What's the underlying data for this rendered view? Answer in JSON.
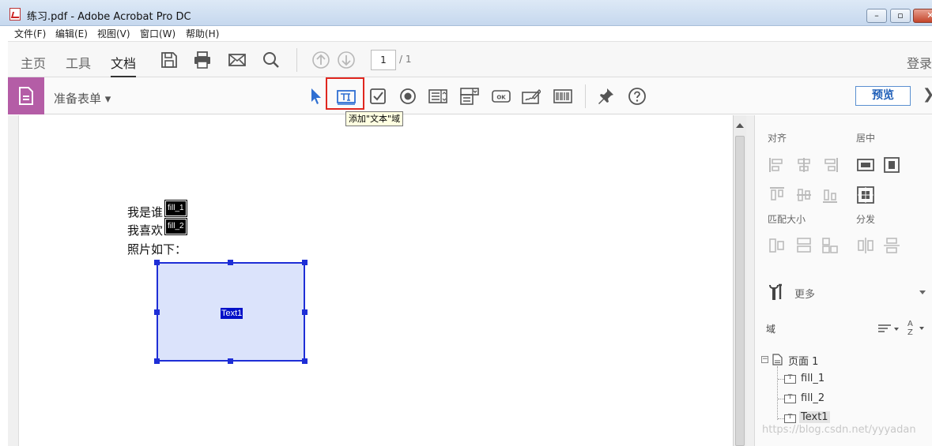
{
  "window": {
    "title": "练习.pdf - Adobe Acrobat Pro DC",
    "minimize": "–",
    "restore": "▫",
    "close": "✕"
  },
  "menu": [
    "文件(F)",
    "编辑(E)",
    "视图(V)",
    "窗口(W)",
    "帮助(H)"
  ],
  "tabs": {
    "home": "主页",
    "tools": "工具",
    "document": "文档"
  },
  "page_nav": {
    "current": "1",
    "total": "/ 1"
  },
  "login": "登录",
  "forms_toolbar": {
    "label": "准备表单 ▾",
    "preview": "预览",
    "chevron": "❯",
    "tooltip": "添加\"文本\"域"
  },
  "document": {
    "lines": [
      "我是谁",
      "我喜欢",
      "照片如下："
    ],
    "field_tags": [
      "fill_1",
      "fill_2"
    ],
    "text_field_label": "Text1"
  },
  "right_panel": {
    "align_heading": "对齐",
    "center_heading": "居中",
    "match_size_heading": "匹配大小",
    "distribute_heading": "分发",
    "more_label": "更多",
    "fields_heading": "域",
    "tree": {
      "page": "页面 1",
      "items": [
        "fill_1",
        "fill_2",
        "Text1"
      ]
    }
  },
  "watermark": "https://blog.csdn.net/yyyadan",
  "colors": {
    "form_badge": "#b45da6",
    "highlight": "#e0271f",
    "field_border": "#1e2ed6",
    "field_fill": "#dbe3fb"
  }
}
